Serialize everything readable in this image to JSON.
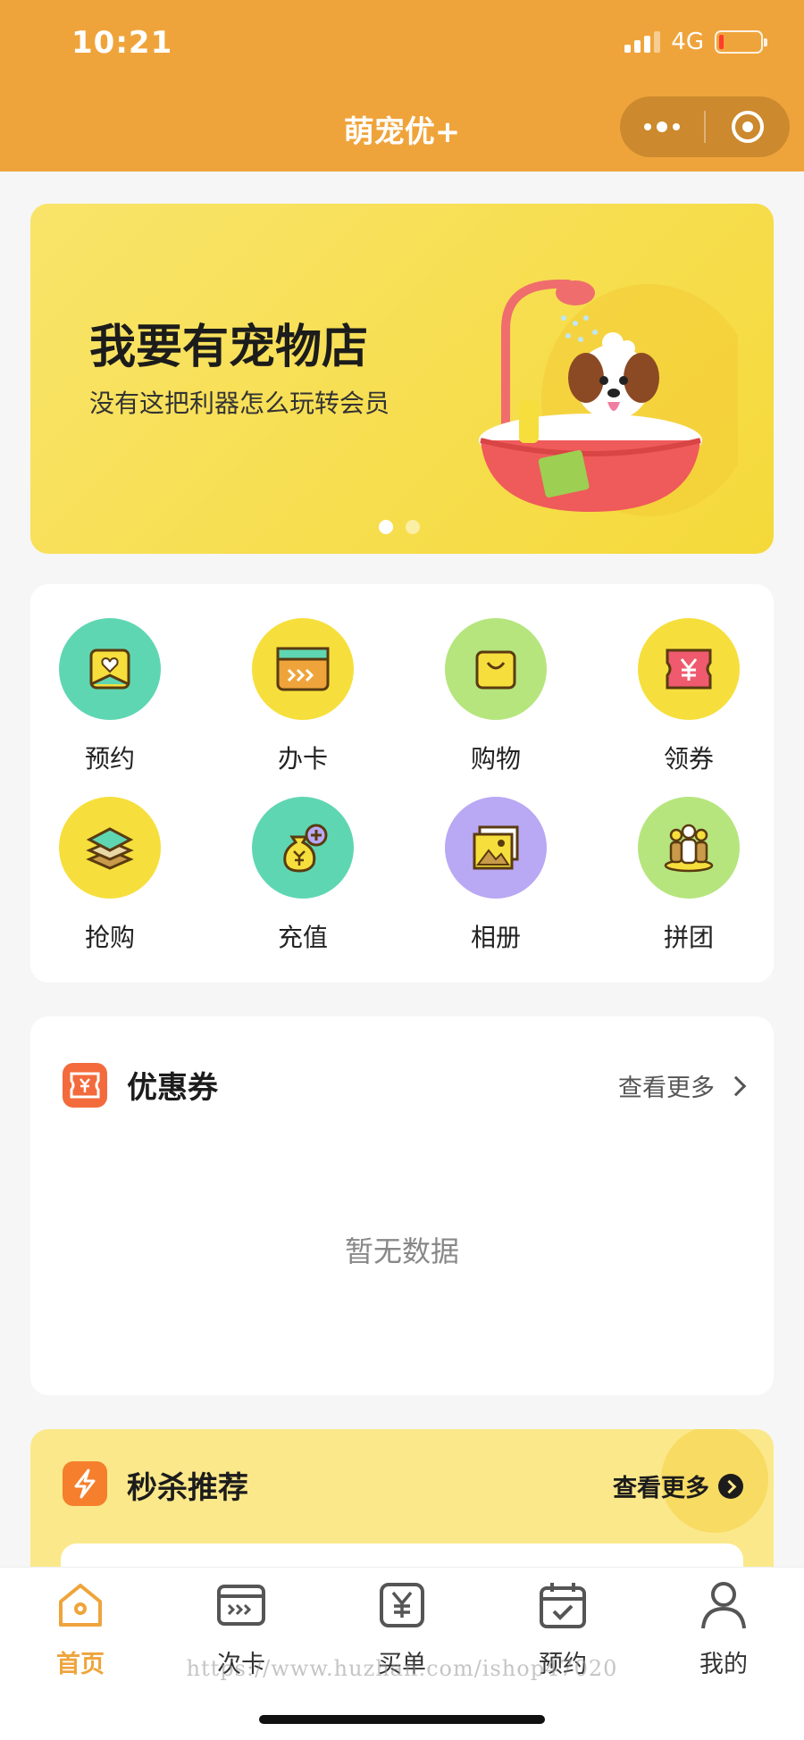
{
  "status_bar": {
    "time": "10:21",
    "network": "4G"
  },
  "nav": {
    "title": "萌宠优+"
  },
  "banner": {
    "title": "我要有宠物店",
    "subtitle": "没有这把利器怎么玩转会员",
    "slide_count": 2,
    "active_slide": 1
  },
  "grid": {
    "items": [
      {
        "label": "预约",
        "icon": "calendar-heart-icon",
        "color": "#5fd6b2"
      },
      {
        "label": "办卡",
        "icon": "card-icon",
        "color": "#f6df3c"
      },
      {
        "label": "购物",
        "icon": "shopping-bag-icon",
        "color": "#b6e57e"
      },
      {
        "label": "领券",
        "icon": "coupon-yen-icon",
        "color": "#f6df3c"
      },
      {
        "label": "抢购",
        "icon": "layers-icon",
        "color": "#f6df3c"
      },
      {
        "label": "充值",
        "icon": "money-bag-icon",
        "color": "#5fd6b2"
      },
      {
        "label": "相册",
        "icon": "photo-album-icon",
        "color": "#b9a8f3"
      },
      {
        "label": "拼团",
        "icon": "group-icon",
        "color": "#b6e57e"
      }
    ]
  },
  "coupons": {
    "title": "优惠券",
    "more": "查看更多",
    "empty_text": "暂无数据"
  },
  "flash_sale": {
    "title": "秒杀推荐",
    "more": "查看更多"
  },
  "tabbar": {
    "items": [
      {
        "label": "首页",
        "icon": "home-icon",
        "active": true
      },
      {
        "label": "次卡",
        "icon": "card-icon",
        "active": false
      },
      {
        "label": "买单",
        "icon": "yen-bill-icon",
        "active": false
      },
      {
        "label": "预约",
        "icon": "calendar-check-icon",
        "active": false
      },
      {
        "label": "我的",
        "icon": "user-icon",
        "active": false
      }
    ]
  },
  "watermark": "https://www.huzhan.com/ishop47020",
  "colors": {
    "brand": "#efa43b",
    "banner": "#f5d93a",
    "coupon_icon": "#f36b3c",
    "flash_bg": "#fbe88a"
  }
}
